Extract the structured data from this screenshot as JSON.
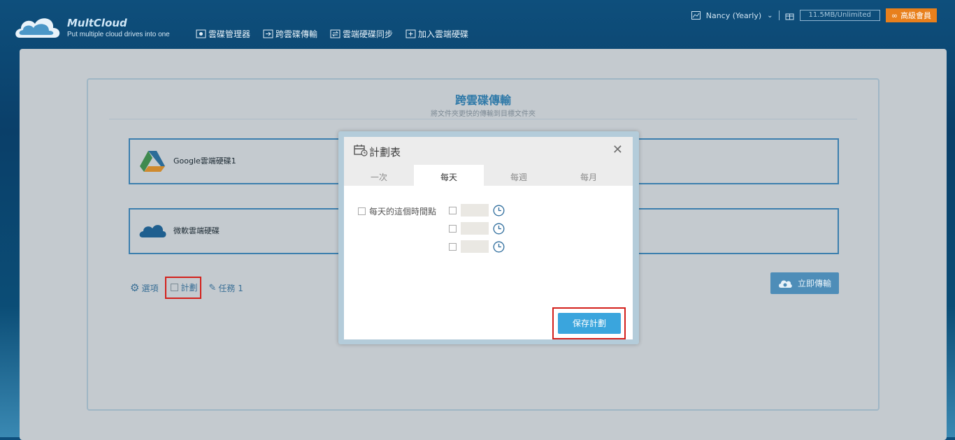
{
  "app": {
    "brand": "MultCloud",
    "tagline": "Put multiple cloud drives into one"
  },
  "nav": [
    {
      "label": "雲碟管理器",
      "icon": "cloud-manager-icon"
    },
    {
      "label": "跨雲碟傳輸",
      "icon": "transfer-icon"
    },
    {
      "label": "雲端硬碟同步",
      "icon": "sync-icon"
    },
    {
      "label": "加入雲端硬碟",
      "icon": "add-cloud-icon"
    }
  ],
  "topbar": {
    "user": "Nancy (Yearly)",
    "storage": "11.5MB/Unlimited",
    "premium": "高級會員"
  },
  "page": {
    "title": "跨雲碟傳輸",
    "subtitle": "將文件夾更快的傳輸到目標文件夾"
  },
  "source": {
    "label": "Google雲端硬碟1",
    "icon": "google-drive-icon"
  },
  "target": {
    "label": "微軟雲端硬碟",
    "icon": "onedrive-icon"
  },
  "options": {
    "options_label": "選項",
    "schedule_label": "計劃",
    "tasks_label": "任務 1"
  },
  "transfer_button": "立即傳輸",
  "modal": {
    "title": "計劃表",
    "tabs": [
      "一次",
      "每天",
      "每週",
      "每月"
    ],
    "active_tab": "每天",
    "schedule_label": "每天的這個時間點",
    "save_label": "保存計劃"
  },
  "colors": {
    "accent": "#3aa5dd",
    "highlight": "#d3201b",
    "premium": "#e8801c"
  }
}
